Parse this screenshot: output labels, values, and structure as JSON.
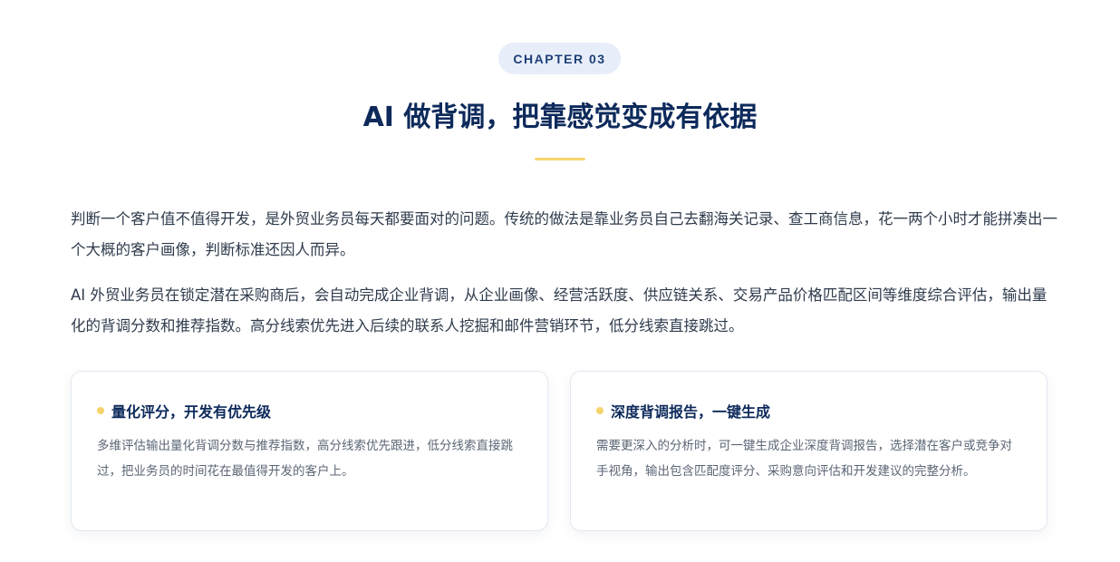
{
  "header": {
    "chapter_label": "CHAPTER 03",
    "title": "AI 做背调，把靠感觉变成有依据"
  },
  "paragraphs": [
    "判断一个客户值不值得开发，是外贸业务员每天都要面对的问题。传统的做法是靠业务员自己去翻海关记录、查工商信息，花一两个小时才能拼凑出一个大概的客户画像，判断标准还因人而异。",
    "AI 外贸业务员在锁定潜在采购商后，会自动完成企业背调，从企业画像、经营活跃度、供应链关系、交易产品价格匹配区间等维度综合评估，输出量化的背调分数和推荐指数。高分线索优先进入后续的联系人挖掘和邮件营销环节，低分线索直接跳过。"
  ],
  "cards": [
    {
      "title": "量化评分，开发有优先级",
      "body": "多维评估输出量化背调分数与推荐指数，高分线索优先跟进，低分线索直接跳过，把业务员的时间花在最值得开发的客户上。"
    },
    {
      "title": "深度背调报告，一键生成",
      "body": "需要更深入的分析时，可一键生成企业深度背调报告，选择潜在客户或竞争对手视角，输出包含匹配度评分、采购意向评估和开发建议的完整分析。"
    }
  ],
  "colors": {
    "title": "#0d2a5b",
    "chapter_pill_bg": "#e7eef9",
    "chapter_pill_text": "#1f3f78",
    "accent": "#f6d46c",
    "body_text": "#2f3b4c",
    "card_text": "#5b6575",
    "card_border": "#e4e8f0"
  }
}
